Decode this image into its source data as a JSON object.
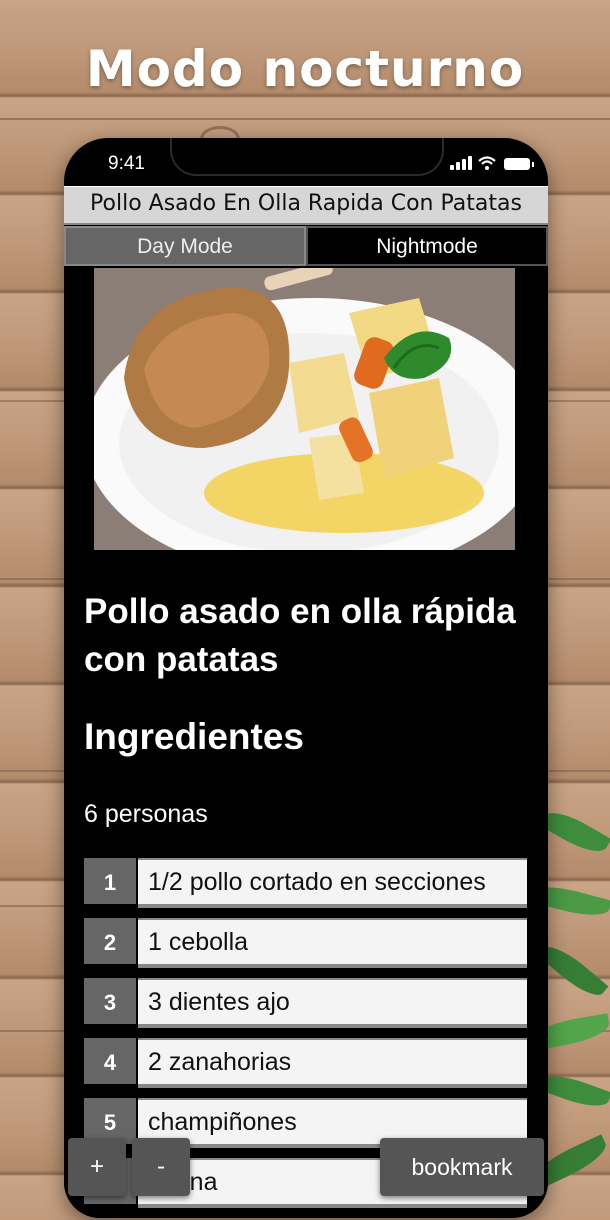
{
  "promo": {
    "title": "Modo nocturno"
  },
  "status_bar": {
    "time": "9:41",
    "icons": [
      "signal-icon",
      "wifi-icon",
      "battery-icon"
    ]
  },
  "app": {
    "title": "Pollo Asado En Olla Rapida Con Patatas",
    "tabs": [
      {
        "label": "Day Mode",
        "active": false
      },
      {
        "label": "Nightmode",
        "active": true
      }
    ]
  },
  "recipe": {
    "title": "Pollo asado en olla rápida con patatas",
    "ingredients_heading": "Ingredientes",
    "servings": "6 personas",
    "ingredients": [
      {
        "num": "1",
        "text": "1/2 pollo cortado en secciones"
      },
      {
        "num": "2",
        "text": "1 cebolla"
      },
      {
        "num": "3",
        "text": "3 dientes ajo"
      },
      {
        "num": "4",
        "text": "2 zanahorias"
      },
      {
        "num": "5",
        "text": "champiñones"
      },
      {
        "num": "6",
        "text": "harina"
      }
    ]
  },
  "controls": {
    "zoom_in": "+",
    "zoom_out": "-",
    "bookmark": "bookmark"
  },
  "colors": {
    "night_bg": "#000000",
    "tab_inactive": "#666666",
    "ingredient_bg": "#f4f4f4"
  }
}
